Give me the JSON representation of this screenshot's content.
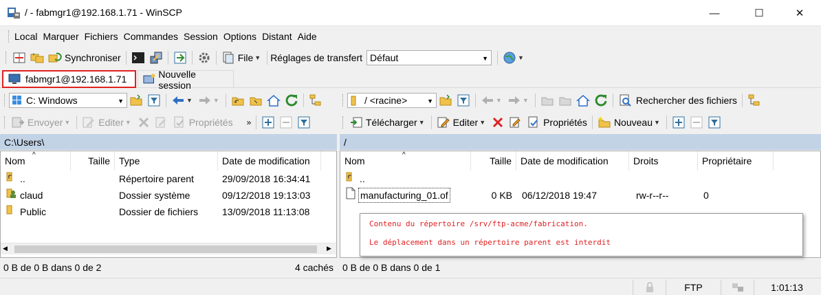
{
  "window": {
    "title": "/ - fabmgr1@192.168.1.71 - WinSCP",
    "controls": {
      "minimize": "—",
      "maximize": "☐",
      "close": "✕"
    }
  },
  "menu": [
    "Local",
    "Marquer",
    "Fichiers",
    "Commandes",
    "Session",
    "Options",
    "Distant",
    "Aide"
  ],
  "toolbar": {
    "sync_label": "Synchroniser",
    "file_label": "File",
    "transfer_settings_label": "Réglages de transfert",
    "transfer_preset": "Défaut"
  },
  "tabs": {
    "session_label": "fabmgr1@192.168.1.71",
    "new_session_label": "Nouvelle session"
  },
  "local": {
    "drive": "C: Windows",
    "actions": {
      "send": "Envoyer",
      "edit": "Editer",
      "properties": "Propriétés"
    },
    "path": "C:\\Users\\",
    "columns": {
      "name": "Nom",
      "size": "Taille",
      "type": "Type",
      "modified": "Date de modification"
    },
    "rows": [
      {
        "name": "..",
        "size": "",
        "type": "Répertoire parent",
        "modified": "29/09/2018  16:34:41"
      },
      {
        "name": "claud",
        "size": "",
        "type": "Dossier système",
        "modified": "09/12/2018  19:13:03"
      },
      {
        "name": "Public",
        "size": "",
        "type": "Dossier de fichiers",
        "modified": "13/09/2018  11:13:08"
      }
    ],
    "status": "0 B de 0 B dans 0 de 2",
    "hidden": "4 cachés"
  },
  "remote": {
    "dir": "/ <racine>",
    "find_label": "Rechercher des fichiers",
    "actions": {
      "download": "Télécharger",
      "edit": "Editer",
      "properties": "Propriétés",
      "new": "Nouveau"
    },
    "path": "/",
    "columns": {
      "name": "Nom",
      "size": "Taille",
      "modified": "Date de modification",
      "rights": "Droits",
      "owner": "Propriétaire"
    },
    "rows": [
      {
        "name": "..",
        "size": "",
        "modified": "",
        "rights": "",
        "owner": ""
      },
      {
        "name": "manufacturing_01.of",
        "size": "0 KB",
        "modified": "06/12/2018 19:47",
        "rights": "rw-r--r--",
        "owner": "0"
      }
    ],
    "status": "0 B de 0 B dans 0 de 1"
  },
  "tooltip": {
    "line1": "Contenu du répertoire /srv/ftp-acme/fabrication.",
    "line2": "Le déplacement dans un répertoire parent est interdit"
  },
  "statusbar": {
    "protocol": "FTP",
    "elapsed": "1:01:13"
  },
  "colors": {
    "accent_red": "#e02020",
    "path_bar": "#c2d3e6",
    "folder": "#f0c24a"
  }
}
